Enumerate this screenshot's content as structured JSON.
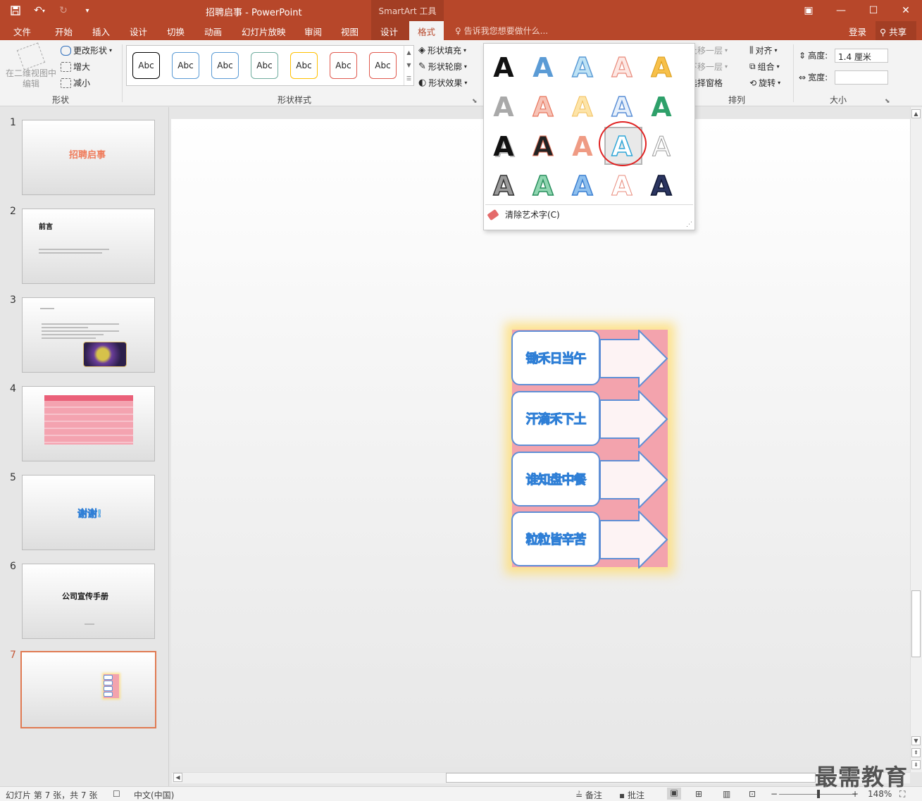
{
  "window": {
    "doc_title": "招聘启事 - PowerPoint",
    "context_tool": "SmartArt 工具",
    "quick_access": {
      "save_icon": "save-icon",
      "undo_icon": "undo-icon",
      "redo_icon": "redo-icon",
      "customize_icon": "customize-icon"
    },
    "controls": {
      "ribbon_options": "▣",
      "minimize": "—",
      "maximize": "☐",
      "close": "✕"
    }
  },
  "tabs": [
    "文件",
    "开始",
    "插入",
    "设计",
    "切换",
    "动画",
    "幻灯片放映",
    "审阅",
    "视图",
    "设计",
    "格式"
  ],
  "active_tab": "格式",
  "tell_me": "告诉我您想要做什么...",
  "account": {
    "login": "登录",
    "share": "共享"
  },
  "ribbon": {
    "shapes_group": {
      "label": "形状",
      "edit_in_2d": "在二维视图中编辑",
      "change_shape": "更改形状",
      "larger": "增大",
      "smaller": "减小"
    },
    "shape_styles_group": {
      "label": "形状样式",
      "swatches": [
        {
          "text": "Abc",
          "border": "#000000"
        },
        {
          "text": "Abc",
          "border": "#5b9bd5"
        },
        {
          "text": "Abc",
          "border": "#5b9bd5"
        },
        {
          "text": "Abc",
          "border": "#70ad9f"
        },
        {
          "text": "Abc",
          "border": "#ffc000"
        },
        {
          "text": "Abc",
          "border": "#e05a4f"
        },
        {
          "text": "Abc",
          "border": "#e05a4f"
        }
      ],
      "fill": "形状填充",
      "outline": "形状轮廓",
      "effects": "形状效果"
    },
    "arrange_group": {
      "label": "排列",
      "bring_forward": "上移一层",
      "send_backward": "下移一层",
      "selection_pane": "选择窗格",
      "align": "对齐",
      "group": "组合",
      "rotate": "旋转"
    },
    "size_group": {
      "label": "大小",
      "height_label": "高度:",
      "height_value": "1.4 厘米",
      "width_label": "宽度:",
      "width_value": ""
    }
  },
  "wordart_gallery": {
    "glyph": "A",
    "clear_label": "清除艺术字(C)",
    "selected_index": 13
  },
  "slides": [
    {
      "number": "1",
      "title": "招聘启事"
    },
    {
      "number": "2",
      "title": "前言"
    },
    {
      "number": "3",
      "title": ""
    },
    {
      "number": "4",
      "title": ""
    },
    {
      "number": "5",
      "title": "谢谢!"
    },
    {
      "number": "6",
      "title": "公司宣传手册"
    },
    {
      "number": "7",
      "title": ""
    }
  ],
  "active_slide": "7",
  "smartart": {
    "items": [
      "锄禾日当午",
      "汗滴禾下土",
      "谁知盘中餐",
      "粒粒皆辛苦"
    ],
    "bg_color": "#f3a3ad",
    "glow_color": "#ffdc6e",
    "outline_color": "#5f8fd6"
  },
  "status": {
    "slide_info": "幻灯片 第 7 张，共 7 张",
    "language": "中文(中国)",
    "notes": "备注",
    "comments": "批注",
    "zoom": "148%"
  },
  "watermark": "最需教育"
}
